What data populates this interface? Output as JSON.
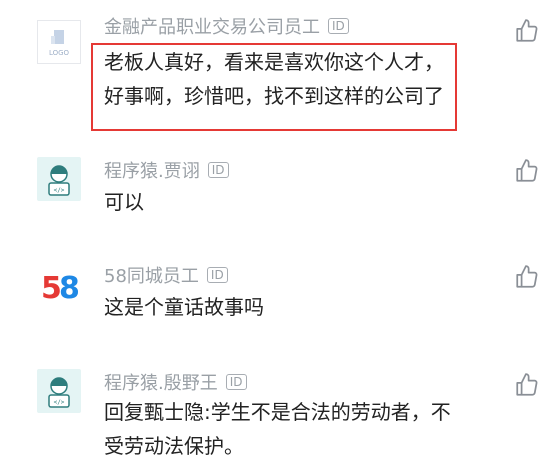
{
  "comments": [
    {
      "user": "金融产品职业交易公司员工",
      "badge": "ID",
      "lines": [
        "老板人真好，看来是喜欢你这个人才，",
        "好事啊，珍惜吧，找不到这样的公司了"
      ],
      "avatar": "logo-placeholder-icon",
      "avatar_text": "LOGO",
      "highlighted": true
    },
    {
      "user": "程序猿.贾诩",
      "badge": "ID",
      "lines": [
        "可以"
      ],
      "avatar": "coder-avatar-icon"
    },
    {
      "user": "58同城员工",
      "badge": "ID",
      "lines": [
        "这是个童话故事吗"
      ],
      "avatar": "58-logo-icon",
      "avatar_text": "58"
    },
    {
      "user": "程序猿.殷野王",
      "badge": "ID",
      "lines": [
        "回复甄士隐:学生不是合法的劳动者，不",
        "受劳动法保护。"
      ],
      "avatar": "coder-avatar-icon"
    }
  ],
  "colors": {
    "username": "#9aa0a6",
    "text": "#222222",
    "highlight": "#e53935",
    "logo_5": "#e53935",
    "logo_8": "#1e88e5",
    "coder_bg": "#e4f4f4"
  },
  "icons": {
    "like": "thumbs-up-icon"
  }
}
